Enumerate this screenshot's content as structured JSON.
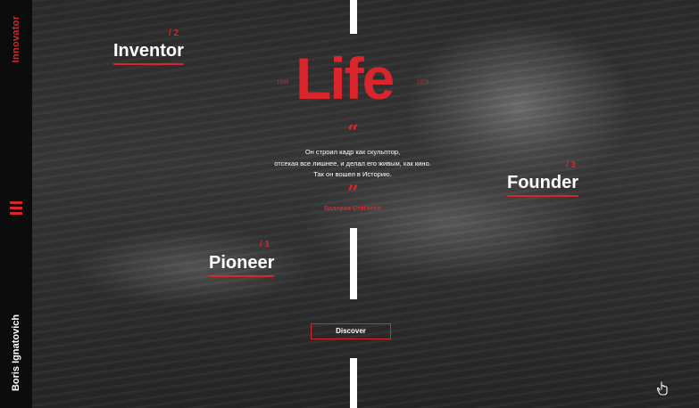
{
  "sidebar": {
    "brand": "Innovator",
    "person_name": "Boris Ignatovich",
    "menu_icon": "hamburger-menu-icon"
  },
  "hero": {
    "title": "Life",
    "year_start": "1899",
    "year_end": "1976",
    "quote_open": "“",
    "quote_lines": [
      "Он строил кадр как скульптор,",
      "отсекая все лишнее, и делал его живым, как кино.",
      "Так он вошел в Историю."
    ],
    "quote_close": "”",
    "author": "Валерия Стигнеев"
  },
  "labels": {
    "inventor": {
      "number": "/ 2",
      "text": "Inventor"
    },
    "founder": {
      "number": "/ 3",
      "text": "Founder"
    },
    "pioneer": {
      "number": "/ 1",
      "text": "Pioneer"
    }
  },
  "cta": {
    "discover": "Discover"
  },
  "colors": {
    "accent": "#d8262c",
    "sidebar": "#0c0c0c",
    "text": "#ffffff"
  },
  "icons": {
    "corner": "hand-pointer-icon"
  }
}
